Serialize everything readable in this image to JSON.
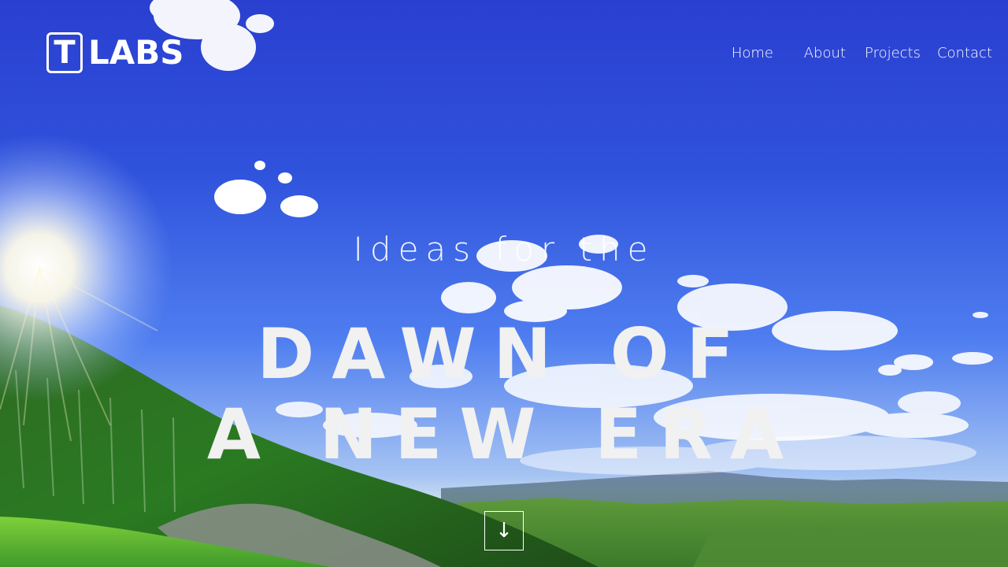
{
  "brand": {
    "logo_letter": "T",
    "logo_text": "LABS"
  },
  "nav": {
    "items": [
      "Home",
      "About",
      "Projects",
      "Contact"
    ]
  },
  "hero": {
    "tagline": "Ideas for the",
    "headline_line1": "DAWN OF",
    "headline_line2": "A NEW ERA",
    "scroll_icon": "arrow-down-icon",
    "scroll_glyph": "↓",
    "background": "sky-landscape"
  },
  "colors": {
    "sky_top": "#2a3fd0",
    "sky_mid": "#4f7ef0",
    "horizon": "#c9dbf2",
    "grass": "#3f9a2a",
    "text": "#ffffff"
  }
}
